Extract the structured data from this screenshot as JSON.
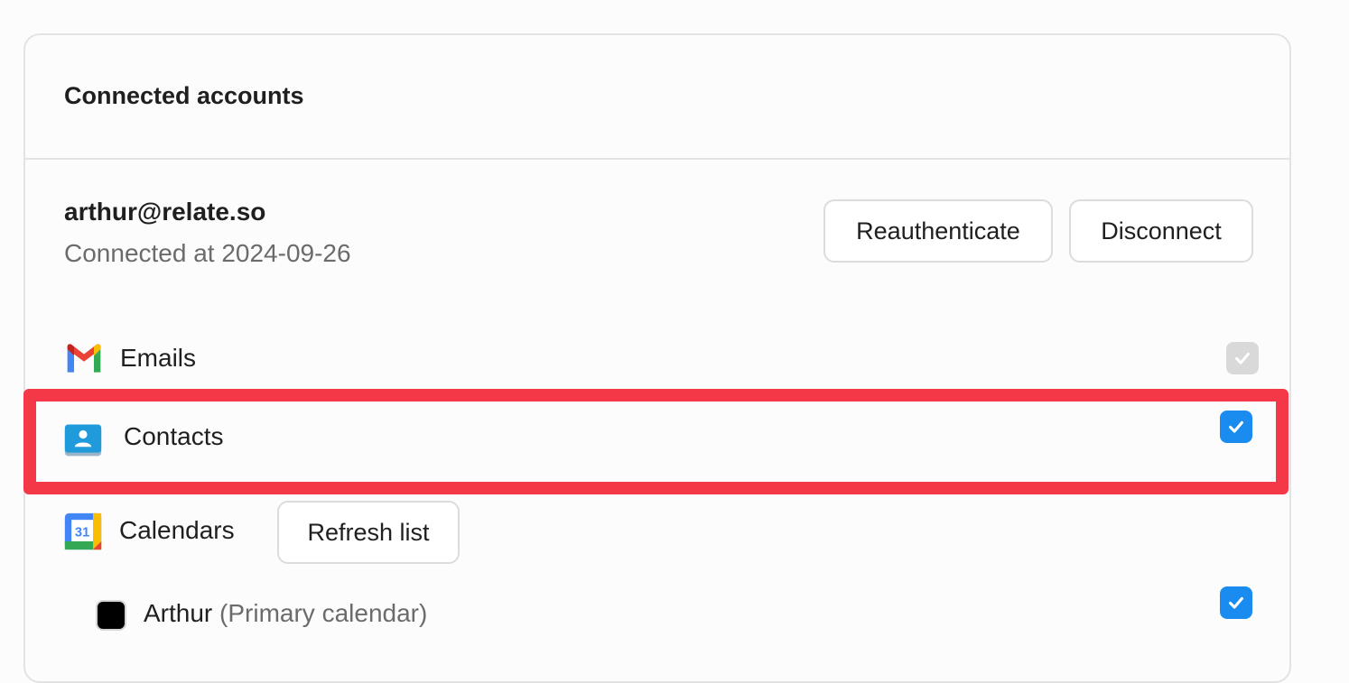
{
  "section": {
    "title": "Connected accounts"
  },
  "account": {
    "email": "arthur@relate.so",
    "connected_text": "Connected at 2024-09-26",
    "reauthenticate_label": "Reauthenticate",
    "disconnect_label": "Disconnect"
  },
  "services": {
    "emails": {
      "label": "Emails",
      "icon": "gmail-icon",
      "checked": true,
      "disabled": true
    },
    "contacts": {
      "label": "Contacts",
      "icon": "contacts-icon",
      "checked": true,
      "highlighted": true
    },
    "calendars": {
      "label": "Calendars",
      "icon": "google-calendar-icon",
      "refresh_label": "Refresh list",
      "icon_day": "31"
    }
  },
  "calendars_list": [
    {
      "name": "Arthur",
      "note": "(Primary calendar)",
      "color": "#000000",
      "checked": true
    }
  ],
  "colors": {
    "accent": "#1a8cf0",
    "highlight": "#f43848",
    "disabled_check": "#d9d9d9"
  }
}
